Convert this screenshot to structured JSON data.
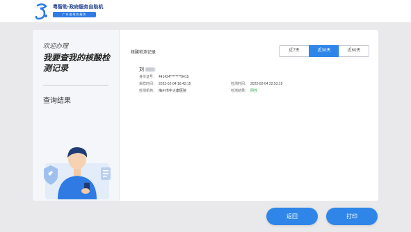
{
  "header": {
    "brand_title": "粤智助·政府服务自助机",
    "brand_sub": "广东省政务服务"
  },
  "sidebar": {
    "welcome": "欢迎办理",
    "heading": "我要查我的核酸检测记录",
    "step": "查询结果"
  },
  "records": {
    "title": "核酸检测记录",
    "filters": [
      {
        "label": "近7天",
        "active": false
      },
      {
        "label": "近30天",
        "active": true
      },
      {
        "label": "近60天",
        "active": false
      }
    ],
    "item": {
      "name_prefix": "刘",
      "id_label": "身份证号：",
      "id_value": "441424********9415",
      "sample_time_label": "采样时间：",
      "sample_time": "2022-02-04 16:42:15",
      "test_time_label": "检测时间：",
      "test_time": "2022-02-04 22:53:19",
      "org_label": "检测机构：",
      "org_value": "梅州市中大康医院",
      "result_label": "检测结果：",
      "result_value": "阴性"
    }
  },
  "footer": {
    "back_label": "返回",
    "print_label": "打印"
  },
  "colors": {
    "accent": "#2f86e8",
    "negative_result": "#2aa84a"
  }
}
